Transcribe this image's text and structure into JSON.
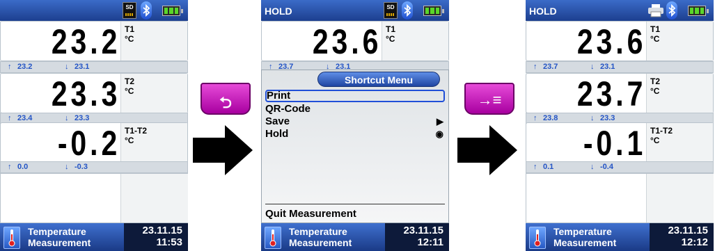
{
  "screens": [
    {
      "status": {
        "hold": ""
      },
      "rows": [
        {
          "value": "23.2",
          "name": "T1",
          "unit": "°C",
          "max": "23.2",
          "min": "23.1"
        },
        {
          "value": "23.3",
          "name": "T2",
          "unit": "°C",
          "max": "23.4",
          "min": "23.3"
        },
        {
          "value": "-0.2",
          "name": "T1-T2",
          "unit": "°C",
          "max": "0.0",
          "min": "-0.3"
        }
      ],
      "bottom": {
        "title_line1": "Temperature",
        "title_line2": "Measurement",
        "date": "23.11.15",
        "time": "11:53"
      }
    },
    {
      "status": {
        "hold": "HOLD"
      },
      "rows": [
        {
          "value": "23.6",
          "name": "T1",
          "unit": "°C",
          "max": "23.7",
          "min": "23.1"
        }
      ],
      "menu": {
        "title": "Shortcut Menu",
        "items": [
          {
            "label": "Print",
            "mark": ""
          },
          {
            "label": "QR-Code",
            "mark": ""
          },
          {
            "label": "Save",
            "mark": "▶"
          },
          {
            "label": "Hold",
            "mark": "◉"
          }
        ],
        "quit": "Quit Measurement"
      },
      "bottom": {
        "title_line1": "Temperature",
        "title_line2": "Measurement",
        "date": "23.11.15",
        "time": "12:11"
      }
    },
    {
      "status": {
        "hold": "HOLD"
      },
      "rows": [
        {
          "value": "23.6",
          "name": "T1",
          "unit": "°C",
          "max": "23.7",
          "min": "23.1"
        },
        {
          "value": "23.7",
          "name": "T2",
          "unit": "°C",
          "max": "23.8",
          "min": "23.3"
        },
        {
          "value": "-0.1",
          "name": "T1-T2",
          "unit": "°C",
          "max": "0.1",
          "min": "-0.4"
        }
      ],
      "bottom": {
        "title_line1": "Temperature",
        "title_line2": "Measurement",
        "date": "23.11.15",
        "time": "12:12"
      }
    }
  ],
  "icons": {
    "sd_card": "SD",
    "bluetooth": "bluetooth-icon",
    "battery": "battery-icon",
    "printer": "printer-icon",
    "thermometer": "thermometer-icon",
    "max_arrow": "↑",
    "min_arrow": "↓"
  },
  "softkeys": {
    "back": "⮌",
    "shortcut": "→≡"
  },
  "colors": {
    "status_blue": "#2a56b4",
    "accent_magenta": "#c020c0",
    "minmax_blue": "#2253c5"
  }
}
